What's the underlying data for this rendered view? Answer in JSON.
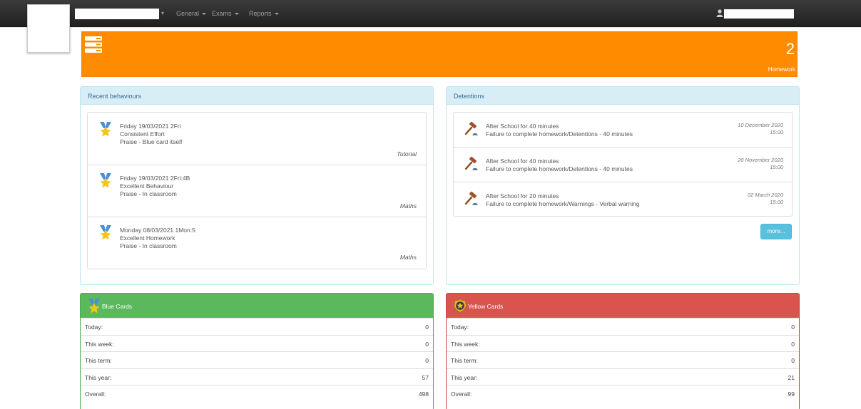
{
  "nav": {
    "items": [
      {
        "label": "General"
      },
      {
        "label": "Exams"
      },
      {
        "label": "Reports"
      }
    ]
  },
  "homework": {
    "count": "2",
    "label": "Homework"
  },
  "behaviours": {
    "title": "Recent behaviours",
    "items": [
      {
        "when": "Friday 19/03/2021 2Fri",
        "type": "Consistent Effort",
        "detail": "Praise - Blue card itself",
        "subject": "Tutorial"
      },
      {
        "when": "Friday 19/03/2021 2Fri:4B",
        "type": "Excellent Behaviour",
        "detail": "Praise - In classroom",
        "subject": "Maths"
      },
      {
        "when": "Monday 08/03/2021 1Mon:5",
        "type": "Excellent Homework",
        "detail": "Praise - In classroom",
        "subject": "Maths"
      }
    ]
  },
  "detentions": {
    "title": "Detentions",
    "more_label": "more...",
    "items": [
      {
        "title": "After School for 40 minutes",
        "reason": "Failure to complete homework/Detentions - 40 minutes",
        "date": "10 December 2020",
        "time": "15:00"
      },
      {
        "title": "After School for 40 minutes",
        "reason": "Failure to complete homework/Detentions - 40 minutes",
        "date": "20 November 2020",
        "time": "15:00"
      },
      {
        "title": "After School for 20 minutes",
        "reason": "Failure to complete homework/Warnings - Verbal warning",
        "date": "02 March 2020",
        "time": "15:00"
      }
    ]
  },
  "blue_cards": {
    "title": "Blue Cards",
    "rows": [
      {
        "label": "Today:",
        "value": "0"
      },
      {
        "label": "This week:",
        "value": "0"
      },
      {
        "label": "This term:",
        "value": "0"
      },
      {
        "label": "This year:",
        "value": "57"
      },
      {
        "label": "Overall:",
        "value": "498"
      }
    ]
  },
  "yellow_cards": {
    "title": "Yellow Cards",
    "rows": [
      {
        "label": "Today:",
        "value": "0"
      },
      {
        "label": "This week:",
        "value": "0"
      },
      {
        "label": "This term:",
        "value": "0"
      },
      {
        "label": "This year:",
        "value": "21"
      },
      {
        "label": "Overall:",
        "value": "99"
      }
    ]
  },
  "colors": {
    "navbar": "#2b2b2b",
    "homework_banner": "#ff8c00",
    "panel_header": "#d9edf7",
    "blue_cards_header": "#5cb85c",
    "yellow_cards_header": "#d9534f",
    "more_button": "#5bc0de"
  },
  "icons": {
    "banner": "server-stack-icon",
    "behaviour": "medal-icon",
    "detention": "gavel-icon",
    "blue_cards": "medal-icon",
    "yellow_cards": "badge-star-icon",
    "user": "user-icon"
  }
}
